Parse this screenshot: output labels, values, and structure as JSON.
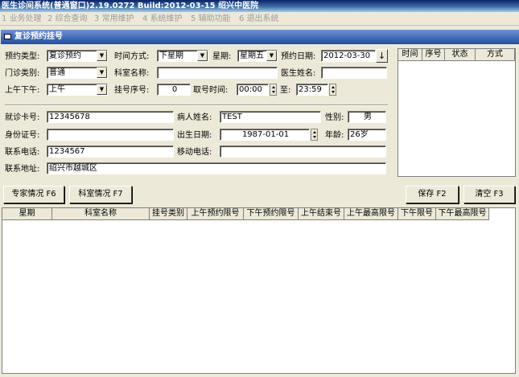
{
  "window": {
    "title": "医生诊间系统(普通窗口)2.19.0272  Build:2012-03-15 绍兴中医院"
  },
  "menu": {
    "items": [
      {
        "key": "1",
        "label": "业务处理"
      },
      {
        "key": "2",
        "label": "综合查询"
      },
      {
        "key": "3",
        "label": "常用维护"
      },
      {
        "key": "4",
        "label": "系统维护"
      },
      {
        "key": "5",
        "label": "辅助功能"
      },
      {
        "key": "6",
        "label": "退出系统"
      }
    ]
  },
  "panel": {
    "title": "复诊预约挂号"
  },
  "form": {
    "appointment_type": {
      "label": "预约类型:",
      "value": "复诊预约"
    },
    "time_mode": {
      "label": "时间方式:",
      "value": "下星期"
    },
    "weekday": {
      "label": "星期:",
      "value": "星期五"
    },
    "appointment_date": {
      "label": "预约日期:",
      "value": "2012-03-30"
    },
    "clinic_type": {
      "label": "门诊类别:",
      "value": "普通"
    },
    "department_name": {
      "label": "科室名称:",
      "value": ""
    },
    "doctor_name": {
      "label": "医生姓名:",
      "value": ""
    },
    "am_pm": {
      "label": "上午下午:",
      "value": "上午"
    },
    "reg_seq": {
      "label": "挂号序号:",
      "value": "0"
    },
    "fetch_time": {
      "label": "取号时间:",
      "from": "00:00",
      "to_label": "至:",
      "to": "23:59"
    },
    "card_no": {
      "label": "就诊卡号:",
      "value": "12345678"
    },
    "patient_name": {
      "label": "病人姓名:",
      "value": "TEST"
    },
    "gender": {
      "label": "性别:",
      "value": "男"
    },
    "id_no": {
      "label": "身份证号:",
      "value": ""
    },
    "birth_date": {
      "label": "出生日期:",
      "value": "1987-01-01"
    },
    "age": {
      "label": "年龄:",
      "value": "26岁"
    },
    "phone": {
      "label": "联系电话:",
      "value": "1234567"
    },
    "mobile": {
      "label": "移动电话:",
      "value": ""
    },
    "address": {
      "label": "联系地址:",
      "value": "绍兴市越城区"
    }
  },
  "right_grid": {
    "columns": [
      "时间",
      "序号",
      "状态",
      "方式"
    ]
  },
  "buttons": {
    "expert": "专家情况 F6",
    "dept": "科室情况 F7",
    "save": "保存 F2",
    "clear": "清空 F3"
  },
  "bottom_grid": {
    "columns": [
      "星期",
      "科室名称",
      "挂号类别",
      "上午预约限号",
      "下午预约限号",
      "上午结束号",
      "上午最高限号",
      "下午限号",
      "下午最高限号"
    ]
  },
  "icons": {
    "date_picker": "down-arrow-icon",
    "dropdown": "chevron-down-icon",
    "spinner": "spinner-icon"
  }
}
